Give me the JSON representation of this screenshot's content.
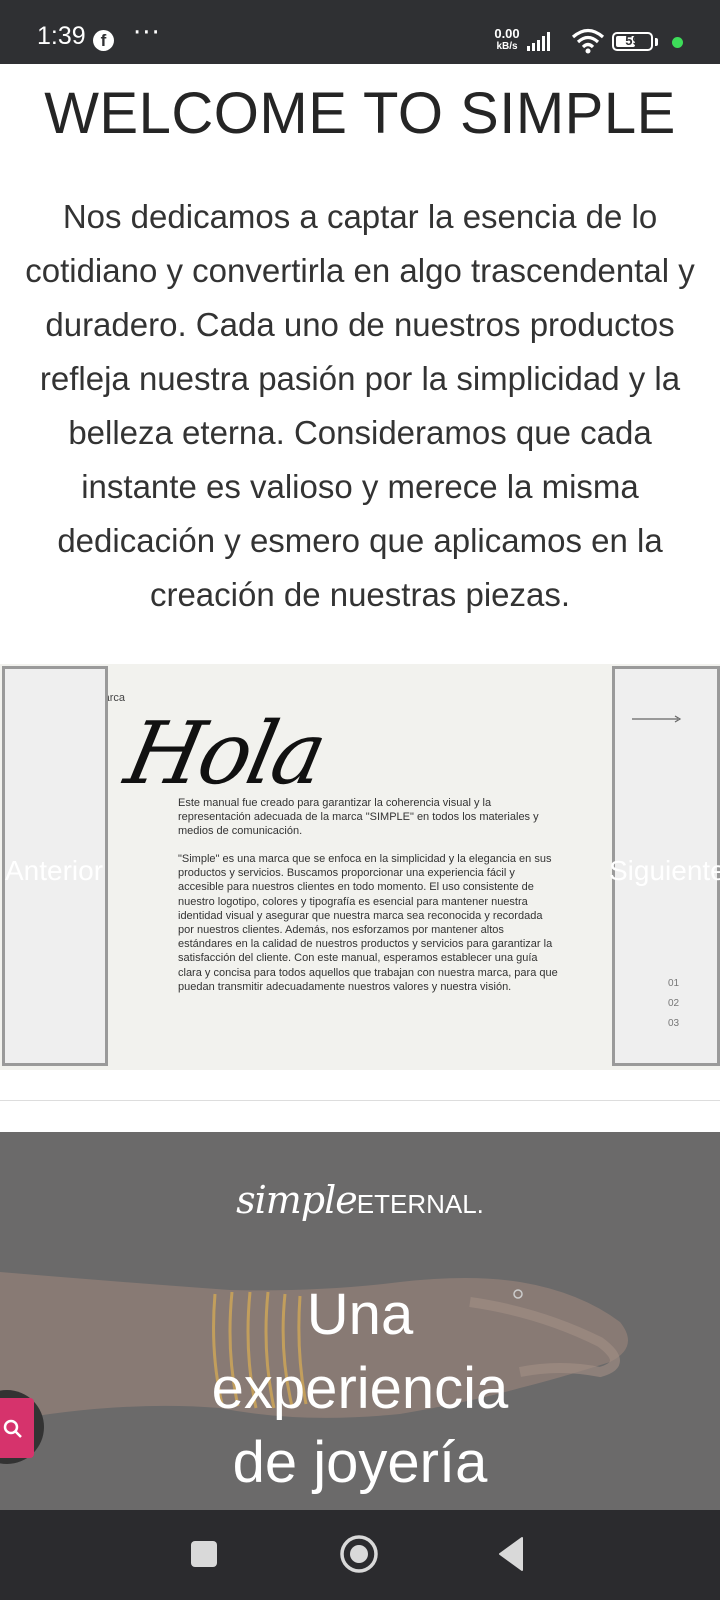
{
  "status_bar": {
    "time": "1:39",
    "more": "···",
    "speed_value": "0.00",
    "speed_unit": "kB/s",
    "battery": "59",
    "battery_level": 0.59,
    "icons": [
      "facebook-icon",
      "signal-icon",
      "wifi-icon",
      "battery-icon"
    ]
  },
  "welcome": {
    "title": "WELCOME TO SIMPLE",
    "intro": "Nos dedicamos a captar la esencia de lo cotidiano y convertirla en algo trascendental y duradero. Cada uno de nuestros productos refleja nuestra pasión por la simplicidad y la belleza eterna. Consideramos que cada instante es valioso y merece la misma dedicación y esmero que aplicamos en la creación de nuestras piezas."
  },
  "slider": {
    "prev_label": "Anterior",
    "next_label": "Siguiente",
    "slide": {
      "label": "Manual de marca",
      "greeting": "Hola",
      "paragraph_1": "Este manual fue creado para garantizar la coherencia visual y la representación adecuada de la marca \"SIMPLE\" en todos los materiales y medios de comunicación.",
      "paragraph_2": "\"Simple\" es una marca que se enfoca en la simplicidad y la elegancia en sus productos y servicios. Buscamos proporcionar una experiencia fácil y accesible para nuestros clientes en todo momento. El uso consistente de nuestro logotipo, colores y tipografía es esencial para mantener nuestra identidad visual y asegurar que nuestra marca sea reconocida y recordada por nuestros clientes. Además, nos esforzamos por mantener altos estándares en la calidad de nuestros productos y servicios para garantizar la satisfacción del cliente. Con este manual, esperamos establecer una guía clara y concisa para todos aquellos que trabajan con nuestra marca, para que puedan transmitir adecuadamente nuestros valores y nuestra visión.",
      "pages": [
        "01",
        "02",
        "03"
      ]
    }
  },
  "hero": {
    "brand_simple": "simple",
    "brand_eternal": "ETERNAL.",
    "title_lines": [
      "Una",
      "experiencia",
      "de joyería"
    ]
  },
  "colors": {
    "status_bar": "#2f3033",
    "slide_bg": "#f2f2ee",
    "hero_bg": "#6b6a6a",
    "fab_accent": "#d6336c",
    "nav_bar": "#2b2b2e"
  }
}
